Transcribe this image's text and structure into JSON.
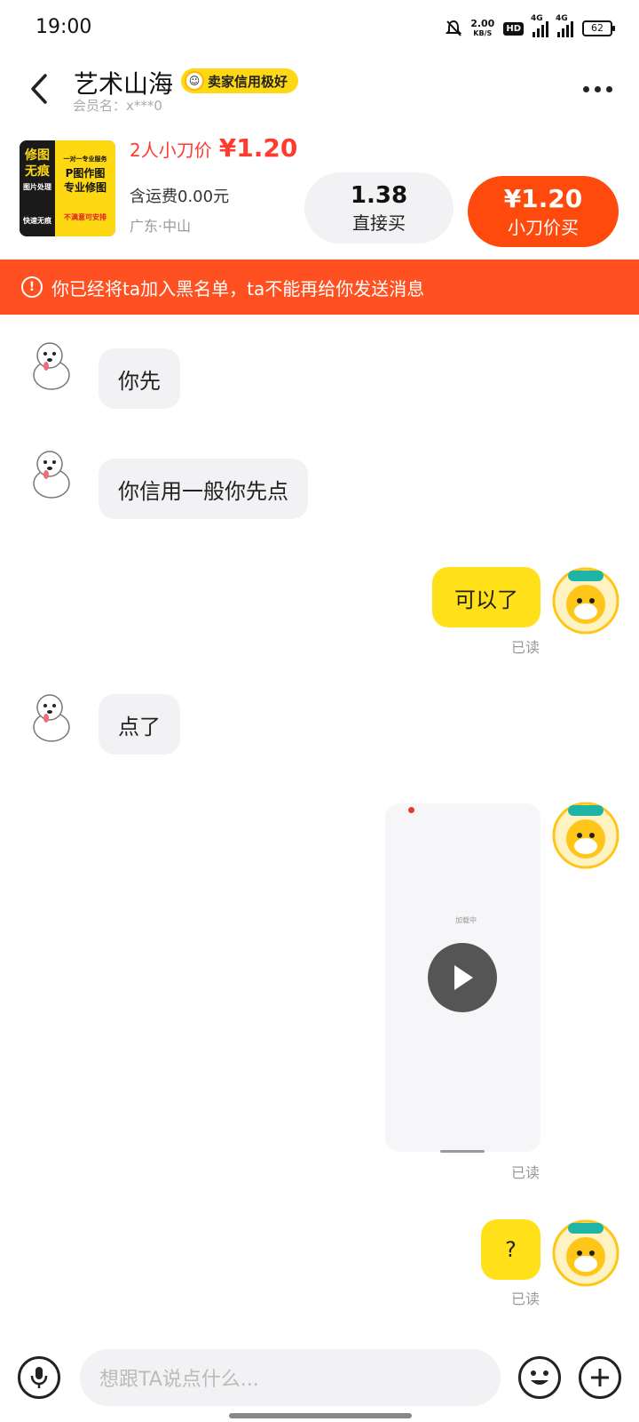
{
  "status_bar": {
    "time": "19:00",
    "net_speed_value": "2.00",
    "net_speed_unit": "KB/S",
    "hd_badge": "HD",
    "signal_1_label": "4G",
    "signal_2_label": "4G",
    "battery": "62",
    "icons": [
      "bell-mute-icon",
      "hd-icon",
      "signal-icon",
      "signal-icon",
      "battery-icon"
    ]
  },
  "header": {
    "title": "艺术山海",
    "seller_badge": "卖家信用极好",
    "member_name": "会员名：x***0"
  },
  "product": {
    "thumb_left": [
      "修图",
      "无痕",
      "图片处理",
      "快速无痕"
    ],
    "thumb_right": [
      "一对一专业服务",
      "P图作图",
      "专业修图",
      "不满意可安排"
    ],
    "deal_label": "2人小刀价",
    "deal_price": "¥1.20",
    "shipping": "含运费0.00元",
    "location": "广东·中山",
    "direct_price": "1.38",
    "direct_label": "直接买",
    "blade_price": "¥1.20",
    "blade_label": "小刀价买"
  },
  "banner": {
    "text": "你已经将ta加入黑名单，ta不能再给你发送消息"
  },
  "messages": [
    {
      "side": "in",
      "text": "你先"
    },
    {
      "side": "in",
      "text": "你信用一般你先点"
    },
    {
      "side": "out",
      "text": "可以了",
      "status": "已读"
    },
    {
      "side": "in",
      "text": "点了"
    },
    {
      "side": "out",
      "type": "video",
      "loading_text": "加载中",
      "status": "已读"
    },
    {
      "side": "out",
      "text": "?",
      "status": "已读"
    }
  ],
  "input": {
    "placeholder": "想跟TA说点什么..."
  },
  "colors": {
    "accent_yellow": "#ffe019",
    "accent_orange": "#ff4a0e",
    "banner_red": "#ff5021",
    "price_red": "#ff3b30"
  }
}
